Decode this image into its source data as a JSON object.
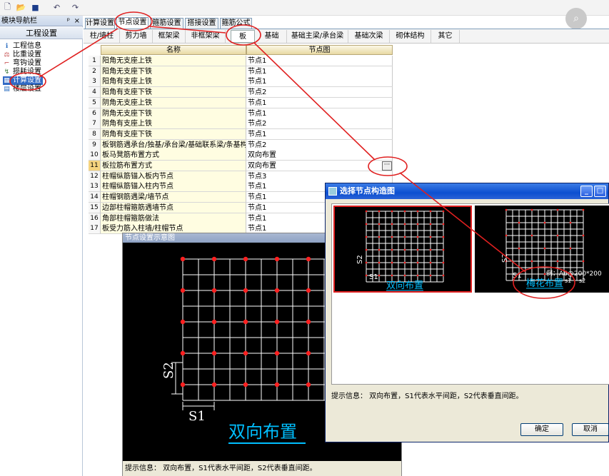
{
  "toolbar": {
    "icons": [
      "new-icon",
      "open-icon",
      "save-icon",
      "undo-icon",
      "redo-icon"
    ]
  },
  "nav": {
    "header": "模块导航栏",
    "pin": "ᵖ",
    "close": "×",
    "title": "工程设置",
    "items": [
      {
        "label": "工程信息",
        "icon": "info-icon"
      },
      {
        "label": "比重设置",
        "icon": "weight-icon"
      },
      {
        "label": "弯钩设置",
        "icon": "hook-icon"
      },
      {
        "label": "损耗设置",
        "icon": "loss-icon"
      },
      {
        "label": "计算设置",
        "icon": "calc-icon"
      },
      {
        "label": "楼层设置",
        "icon": "floor-icon"
      }
    ]
  },
  "tabs": [
    "计算设置",
    "节点设置",
    "箍筋设置",
    "搭接设置",
    "箍筋公式"
  ],
  "selected_tab": 1,
  "subtabs": [
    "柱/墙柱",
    "剪力墙",
    "框架梁",
    "非框架梁",
    "板",
    "基础",
    "基础主梁/承台梁",
    "基础次梁",
    "砌体结构",
    "其它"
  ],
  "grid": {
    "col_name": "名称",
    "col_value": "节点图",
    "rows": [
      {
        "n": "1",
        "name": "阳角无支座上铁",
        "value": "节点1"
      },
      {
        "n": "2",
        "name": "阳角无支座下铁",
        "value": "节点1"
      },
      {
        "n": "3",
        "name": "阳角有支座上铁",
        "value": "节点1"
      },
      {
        "n": "4",
        "name": "阳角有支座下铁",
        "value": "节点2"
      },
      {
        "n": "5",
        "name": "阴角无支座上铁",
        "value": "节点1"
      },
      {
        "n": "6",
        "name": "阴角无支座下铁",
        "value": "节点1"
      },
      {
        "n": "7",
        "name": "阴角有支座上铁",
        "value": "节点2"
      },
      {
        "n": "8",
        "name": "阴角有支座下铁",
        "value": "节点1"
      },
      {
        "n": "9",
        "name": "板钢筋遇承台/独基/承台梁/基础联系梁/条基构",
        "value": "节点2"
      },
      {
        "n": "10",
        "name": "板马凳筋布置方式",
        "value": "双向布置"
      },
      {
        "n": "11",
        "name": "板拉筋布置方式",
        "value": "双向布置"
      },
      {
        "n": "12",
        "name": "柱帽纵筋锚入板内节点",
        "value": "节点3"
      },
      {
        "n": "13",
        "name": "柱帽纵筋锚入柱内节点",
        "value": "节点1"
      },
      {
        "n": "14",
        "name": "柱帽钢筋遇梁/墙节点",
        "value": "节点1"
      },
      {
        "n": "15",
        "name": "边部柱帽箍筋遇墙节点",
        "value": "节点1"
      },
      {
        "n": "16",
        "name": "角部柱帽箍筋做法",
        "value": "节点1"
      },
      {
        "n": "17",
        "name": "板受力筋入柱墙/柱帽节点",
        "value": "节点1"
      }
    ]
  },
  "ellipsis": "···",
  "diagram": {
    "title": "节点设置示意图",
    "s1": "S1",
    "s2": "S2",
    "caption": "双向布置",
    "hint": "提示信息： 双向布置，S1代表水平间距，S2代表垂直间距。"
  },
  "dialog": {
    "title": "选择节点构造图",
    "options": [
      {
        "caption": "双向布置",
        "s1": "S1",
        "s2": "S2"
      },
      {
        "caption": "梅花布置",
        "s1": "S1",
        "s2": "S2",
        "note": "例：A6@200*200",
        "note_s1": "s1",
        "note_s2": "s2"
      }
    ],
    "hint": "提示信息： 双向布置，S1代表水平间距，S2代表垂直间距。",
    "ok": "确定",
    "cancel": "取消"
  },
  "colors": {
    "annotation": "#e02020",
    "grid_dot": "#ff2020",
    "caption": "#00bfff"
  }
}
